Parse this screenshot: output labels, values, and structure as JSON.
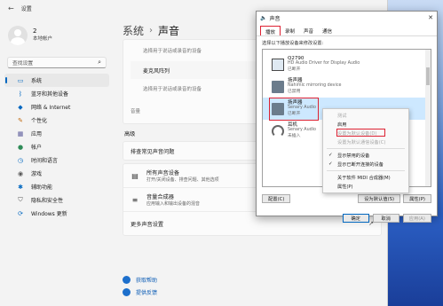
{
  "settings": {
    "title": "设置",
    "back_icon": "back-arrow-icon",
    "profile": {
      "name": "2",
      "account": "本地帐户"
    },
    "search": {
      "placeholder": "查找设置"
    },
    "nav": [
      {
        "label": "系统",
        "icon": "monitor-icon",
        "active": true
      },
      {
        "label": "蓝牙和其他设备",
        "icon": "bluetooth-icon"
      },
      {
        "label": "网络 & Internet",
        "icon": "wifi-icon"
      },
      {
        "label": "个性化",
        "icon": "brush-icon"
      },
      {
        "label": "应用",
        "icon": "apps-icon"
      },
      {
        "label": "帐户",
        "icon": "person-icon"
      },
      {
        "label": "时间和语言",
        "icon": "globe-clock-icon"
      },
      {
        "label": "游戏",
        "icon": "gamepad-icon"
      },
      {
        "label": "辅助功能",
        "icon": "accessibility-icon"
      },
      {
        "label": "隐私和安全性",
        "icon": "shield-icon"
      },
      {
        "label": "Windows 更新",
        "icon": "update-icon"
      }
    ],
    "breadcrumb": {
      "parent": "系统",
      "current": "声音"
    },
    "input_section": {
      "mic_label": "麦克风阵列",
      "note": "选择用于说话或录音的设备",
      "volume_label": "音量"
    },
    "advanced": {
      "title": "高级",
      "troubleshoot": "排查常见声音问题",
      "all_devices": {
        "label": "所有声音设备",
        "sub": "打开/关闭设备、排查问题、其他选项"
      },
      "mixer": {
        "label": "音量合成器",
        "sub": "应用输入和输出设备的混音"
      },
      "more": "更多声音设置"
    },
    "help": {
      "get_help": "获取帮助",
      "feedback": "提供反馈"
    }
  },
  "dialog": {
    "title": "声音",
    "close_icon": "close-icon",
    "tabs": [
      "播放",
      "录制",
      "声音",
      "通信"
    ],
    "hint": "选择以下播放设备来修改设置:",
    "devices": [
      {
        "name": "Q2790",
        "sub1": "HD Audio Driver for Display Audio",
        "sub2": "已断开",
        "icon": "monitor-icon"
      },
      {
        "name": "扬声器",
        "sub1": "Nahimic mirroring device",
        "sub2": "已禁用",
        "icon": "speaker-icon"
      },
      {
        "name": "扬声器",
        "sub1": "Senary Audio",
        "sub2": "已断开",
        "icon": "speaker-icon",
        "selected": true
      },
      {
        "name": "耳机",
        "sub1": "Senary Audio",
        "sub2": "未插入",
        "icon": "headset-icon"
      }
    ],
    "configure_label": "配置(C)",
    "default_label": "设为默认值(S)",
    "properties_label": "属性(P)",
    "ok_label": "确定",
    "cancel_label": "取消",
    "apply_label": "应用(A)"
  },
  "context_menu": {
    "items": [
      {
        "label": "测试",
        "disabled": true
      },
      {
        "label": "启用",
        "disabled": false
      },
      {
        "label": "设置为默认设备(D)",
        "disabled": true
      },
      {
        "label": "设置为默认通信设备(C)",
        "disabled": true
      },
      {
        "sep": true
      },
      {
        "label": "显示禁用的设备",
        "checked": true
      },
      {
        "label": "显示已断开连接的设备",
        "checked": true
      },
      {
        "sep": true
      },
      {
        "label": "关于软件 MIDI 合成器(M)"
      },
      {
        "label": "属性(P)"
      }
    ]
  },
  "colors": {
    "accent": "#0067c0",
    "highlight_red": "#dd2233",
    "selection": "#cde8ff"
  }
}
